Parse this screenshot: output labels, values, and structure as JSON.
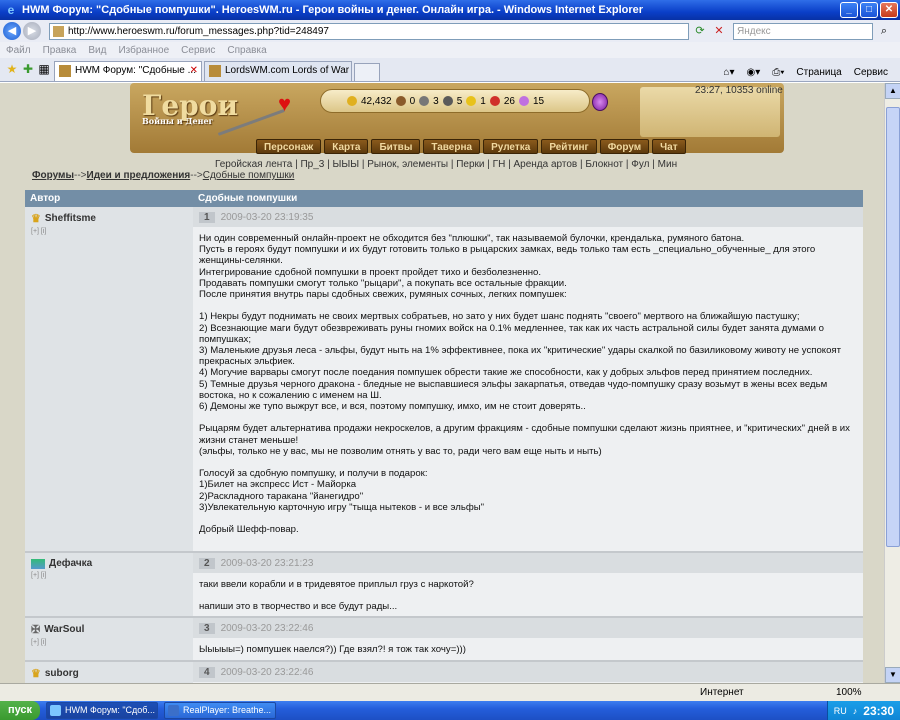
{
  "window": {
    "title": "HWM Форум: \"Сдобные помпушки\". HeroesWM.ru - Герои войны и денег. Онлайн игра. - Windows Internet Explorer",
    "minimize": "_",
    "maximize": "□",
    "close": "✕"
  },
  "address_bar": {
    "url": "http://www.heroeswm.ru/forum_messages.php?tid=248497",
    "search_placeholder": "Яндекс"
  },
  "menu": [
    "Файл",
    "Правка",
    "Вид",
    "Избранное",
    "Сервис",
    "Справка"
  ],
  "tabs": [
    {
      "label": "HWM Форум: \"Сдобные ...",
      "active": true
    },
    {
      "label": "LordsWM.com Lords of War ...",
      "active": false
    }
  ],
  "ie_toolbar": {
    "page": "Страница",
    "tools": "Сервис"
  },
  "game": {
    "logo_text": "Герои",
    "logo_sub": "Войны и Денег",
    "time_online": "23:27, 10353 online",
    "resources": [
      "42,432",
      "0",
      "3",
      "5",
      "1",
      "26",
      "15"
    ],
    "nav": [
      "Персонаж",
      "Карта",
      "Битвы",
      "Таверна",
      "Рулетка",
      "Рейтинг",
      "Форум",
      "Чат"
    ],
    "sublinks": "Геройская лента | Пр_3 | ЫЫЫ | Рынок, элементы | Перки | ГН | Аренда артов | Блокнот | Фул | Мин"
  },
  "breadcrumb": {
    "forums": "Форумы",
    "sep1": "-->",
    "section": "Идеи и предложения",
    "sep2": "-->",
    "topic": "Сдобные помпушки"
  },
  "table": {
    "col_author": "Автор",
    "col_topic": "Сдобные помпушки"
  },
  "posts": [
    {
      "num": "1",
      "date": "2009-03-20 23:19:35",
      "author": "Sheffitsme",
      "mini": "[+] [i]",
      "text": "Ни один современный онлайн-проект не обходится без \"плюшки\", так называемой булочки, крендалька, румяного батона.\nПусть в героях будут помпушки и их будут готовить только в рыцарских замках, ведь только там есть _специально_обученные_ для этого женщины-селянки.\nИнтегрирование сдобной помпушки в проект пройдет тихо и безболезненно.\nПродавать помпушки смогут только \"рыцари\", а покупать все остальные фракции.\nПосле принятия внутрь пары сдобных свежих, румяных сочных, легких помпушек:\n\n1) Некры будут поднимать не своих мертвых собратьев, но зато у них будет шанс поднять \"своего\" мертвого на ближайшую пастушку;\n2) Всезнающие маги будут обезвреживать руны гномих войск на 0.1% медленнее, так как их часть астральной силы будет занята думами о помпушках;\n3) Маленькие друзья леса - эльфы, будут ныть на 1% эффективнее, пока их \"критические\" удары скалкой по базиликовому животу не успокоят прекрасных эльфиек.\n4) Могучие варвары смогут после поедания помпушек обрести такие же способности, как у добрых эльфов перед принятием последних.\n5) Темные друзья черного дракона - бледные не выспавшиеся эльфы закарпатья, отведав чудо-помпушку сразу возьмут в жены всех ведьм востока, но к сожалению с именем на Ш.\n6) Демоны же тупо выжрут все, и вся, поэтому помпушку, имхо, им не стоит доверять..\n\nРыцарям будет альтернатива продажи некроскелов, а другим фракциям - сдобные помпушки сделают жизнь приятнее, и \"критических\" дней в их жизни станет меньше!\n(эльфы, только не у вас, мы не позволим отнять у вас то, ради чего вам еще ныть и ныть)\n\nГолосуй за сдобную помпушку, и получи в подарок:\n1)Билет на экспресс Ист - Майорка\n2)Раскладного таракана \"йанегидро\"\n3)Увлекательную карточную игру \"тыща нытеков - и все эльфы\"\n\nДобрый Шефф-повар."
    },
    {
      "num": "2",
      "date": "2009-03-20 23:21:23",
      "author": "Дефачка",
      "mini": "[+] [i]",
      "text": "таки ввели корабли и в тридевятое приплыл груз с наркотой?\n\nнапиши это в творчество и все будут рады..."
    },
    {
      "num": "3",
      "date": "2009-03-20 23:22:46",
      "author": "WarSoul",
      "mini": "[+] [i]",
      "text": "Ыыыыы=) помпушек наелся?)) Где взял?! я тож так хочу=)))"
    },
    {
      "num": "4",
      "date": "2009-03-20 23:22:46",
      "author": "suborg",
      "mini": "",
      "text": ""
    }
  ],
  "statusbar": {
    "zone": "Интернет",
    "zoom": "100%"
  },
  "taskbar": {
    "start": "пуск",
    "tasks": [
      {
        "label": "HWM Форум: \"Сдоб...",
        "active": true
      },
      {
        "label": "RealPlayer: Breathe...",
        "active": false
      }
    ],
    "lang": "RU",
    "clock": "23:30"
  }
}
